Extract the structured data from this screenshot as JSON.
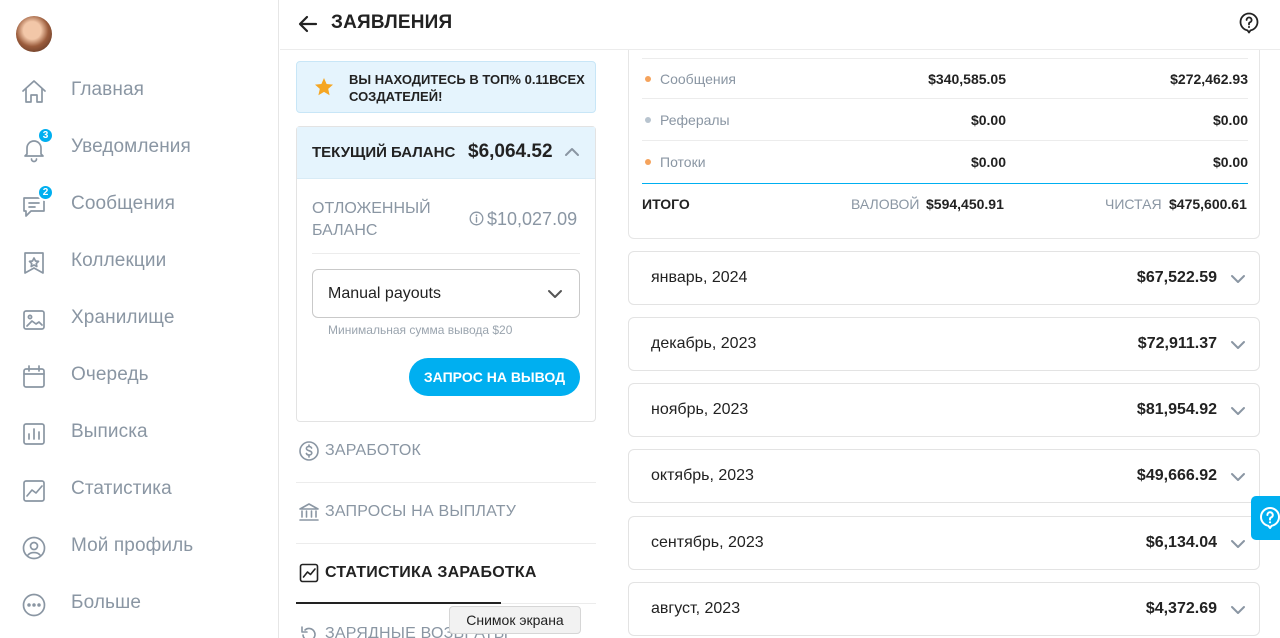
{
  "sidebar": {
    "items": [
      {
        "label": "Главная",
        "icon": "home-icon"
      },
      {
        "label": "Уведомления",
        "icon": "bell-icon",
        "badge": "3"
      },
      {
        "label": "Сообщения",
        "icon": "message-icon",
        "badge": "2"
      },
      {
        "label": "Коллекции",
        "icon": "collections-icon"
      },
      {
        "label": "Хранилище",
        "icon": "vault-icon"
      },
      {
        "label": "Очередь",
        "icon": "calendar-icon"
      },
      {
        "label": "Выписка",
        "icon": "statements-icon"
      },
      {
        "label": "Статистика",
        "icon": "statistics-icon"
      },
      {
        "label": "Мой профиль",
        "icon": "profile-icon"
      },
      {
        "label": "Больше",
        "icon": "more-icon"
      }
    ]
  },
  "header": {
    "title": "ЗАЯВЛЕНИЯ"
  },
  "top_banner": {
    "text": "ВЫ НАХОДИТЕСЬ В ТОП% 0.11ВСЕХ СОЗДАТЕЛЕЙ!"
  },
  "balance": {
    "current_label": "ТЕКУЩИЙ БАЛАНС",
    "current_value": "$6,064.52",
    "pending_label": "ОТЛОЖЕННЫЙ БАЛАНС",
    "pending_value": "$10,027.09",
    "payout_mode": "Manual payouts",
    "min_note": "Минимальная сумма вывода $20",
    "withdraw_label": "ЗАПРОС НА ВЫВОД"
  },
  "sections": {
    "earnings": "ЗАРАБОТОК",
    "payout_requests": "ЗАПРОСЫ НА ВЫПЛАТУ",
    "earnings_stats": "СТАТИСТИКА ЗАРАБОТКА",
    "chargebacks": "ЗАРЯДНЫЕ ВОЗВРАТЫ"
  },
  "tooltip": "Снимок экрана",
  "summary": {
    "rows": [
      {
        "name": "Сообщения",
        "gross": "$340,585.05",
        "net": "$272,462.93",
        "dot_color": "#f5a35c"
      },
      {
        "name": "Рефералы",
        "gross": "$0.00",
        "net": "$0.00",
        "dot_color": "#b8c4cf"
      },
      {
        "name": "Потоки",
        "gross": "$0.00",
        "net": "$0.00",
        "dot_color": "#f5a35c"
      }
    ],
    "total_label": "ИТОГО",
    "gross_label": "ВАЛОВОЙ",
    "gross_total": "$594,450.91",
    "net_label": "ЧИСТАЯ",
    "net_total": "$475,600.61"
  },
  "months": [
    {
      "name": "январь, 2024",
      "value": "$67,522.59"
    },
    {
      "name": "декабрь, 2023",
      "value": "$72,911.37"
    },
    {
      "name": "ноябрь, 2023",
      "value": "$81,954.92"
    },
    {
      "name": "октябрь, 2023",
      "value": "$49,666.92"
    },
    {
      "name": "сентябрь, 2023",
      "value": "$6,134.04"
    },
    {
      "name": "август, 2023",
      "value": "$4,372.69"
    }
  ],
  "colors": {
    "accent": "#00aff0",
    "muted": "#8a96a3",
    "banner_bg": "#e5f4fd"
  }
}
